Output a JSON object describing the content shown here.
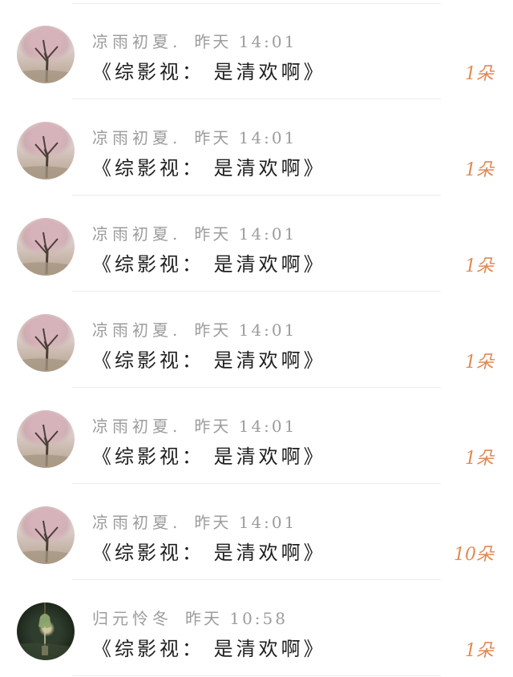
{
  "comments": [
    {
      "user": "凉雨初夏.",
      "date": "昨天",
      "time": "14:01",
      "title": "《综影视： 是清欢啊》",
      "count": "1朵",
      "avatar": "tree-avatar"
    },
    {
      "user": "凉雨初夏.",
      "date": "昨天",
      "time": "14:01",
      "title": "《综影视： 是清欢啊》",
      "count": "1朵",
      "avatar": "tree-avatar"
    },
    {
      "user": "凉雨初夏.",
      "date": "昨天",
      "time": "14:01",
      "title": "《综影视： 是清欢啊》",
      "count": "1朵",
      "avatar": "tree-avatar"
    },
    {
      "user": "凉雨初夏.",
      "date": "昨天",
      "time": "14:01",
      "title": "《综影视： 是清欢啊》",
      "count": "1朵",
      "avatar": "tree-avatar"
    },
    {
      "user": "凉雨初夏.",
      "date": "昨天",
      "time": "14:01",
      "title": "《综影视： 是清欢啊》",
      "count": "1朵",
      "avatar": "tree-avatar"
    },
    {
      "user": "凉雨初夏.",
      "date": "昨天",
      "time": "14:01",
      "title": "《综影视： 是清欢啊》",
      "count": "10朵",
      "avatar": "tree-avatar"
    },
    {
      "user": "归元怜冬",
      "date": "昨天",
      "time": "10:58",
      "title": "《综影视： 是清欢啊》",
      "count": "1朵",
      "avatar": "bell-avatar"
    }
  ],
  "colors": {
    "meta_text": "#9c9c9c",
    "title_text": "#1f1f1f",
    "count_text": "#e08a55",
    "divider": "#ececec"
  }
}
